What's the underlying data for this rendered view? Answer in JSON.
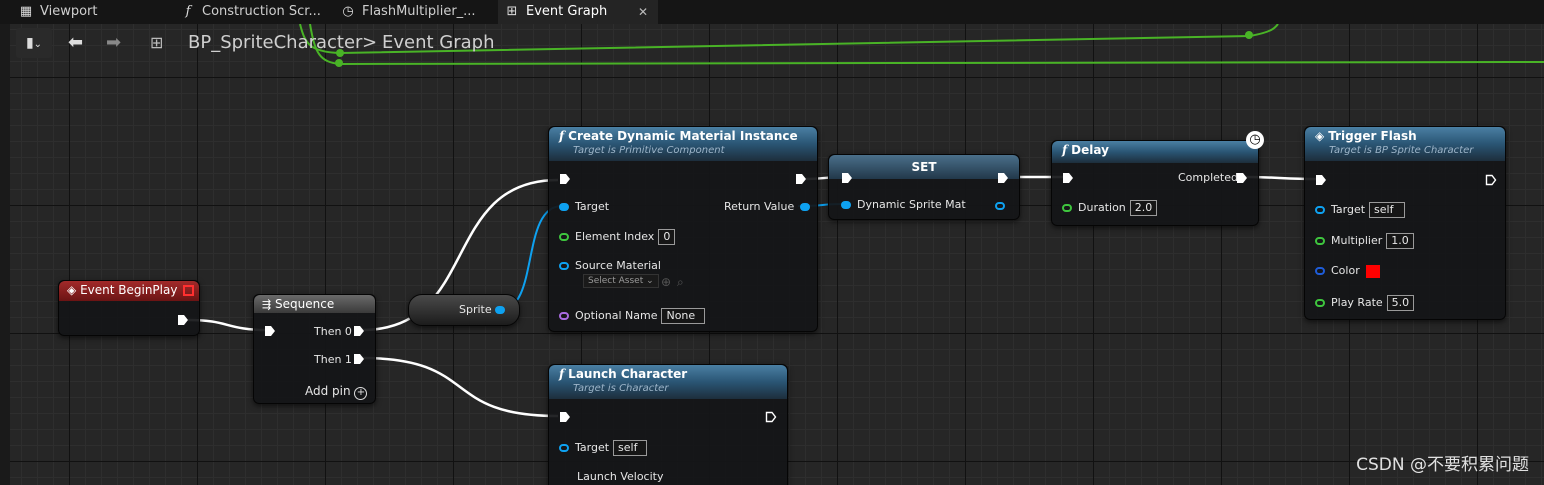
{
  "tabs": [
    {
      "label": "Viewport",
      "icon": "grid-icon"
    },
    {
      "label": "Construction Scr...",
      "icon": "function-icon"
    },
    {
      "label": "FlashMultiplier_...",
      "icon": "clock-icon"
    },
    {
      "label": "Event Graph",
      "icon": "graph-icon",
      "close": "✕"
    }
  ],
  "toolbar": {
    "breadcrumb_root": "BP_SpriteCharacter",
    "separator": ">",
    "breadcrumb_current": "Event Graph"
  },
  "nodes": {
    "begin_play": {
      "title": "Event BeginPlay"
    },
    "sequence": {
      "title": "Sequence",
      "then0": "Then 0",
      "then1": "Then 1",
      "add_pin": "Add pin"
    },
    "sprite": {
      "label": "Sprite"
    },
    "create_dmi": {
      "title": "Create Dynamic Material Instance",
      "subtitle": "Target is Primitive Component",
      "target": "Target",
      "return_value": "Return Value",
      "element_index": "Element Index",
      "element_index_value": "0",
      "source_material": "Source Material",
      "select_asset": "Select Asset",
      "optional_name": "Optional Name",
      "optional_name_value": "None"
    },
    "set": {
      "title": "SET",
      "var": "Dynamic Sprite Mat"
    },
    "delay": {
      "title": "Delay",
      "completed": "Completed",
      "duration": "Duration",
      "duration_value": "2.0"
    },
    "trigger_flash": {
      "title": "Trigger Flash",
      "subtitle": "Target is BP Sprite Character",
      "target": "Target",
      "target_value": "self",
      "multiplier": "Multiplier",
      "multiplier_value": "1.0",
      "color": "Color",
      "color_value": "#ff0000",
      "play_rate": "Play Rate",
      "play_rate_value": "5.0"
    },
    "launch": {
      "title": "Launch Character",
      "subtitle": "Target is Character",
      "target": "Target",
      "target_value": "self",
      "velocity": "Launch Velocity"
    }
  },
  "watermark": "CSDN @不要积累问题"
}
